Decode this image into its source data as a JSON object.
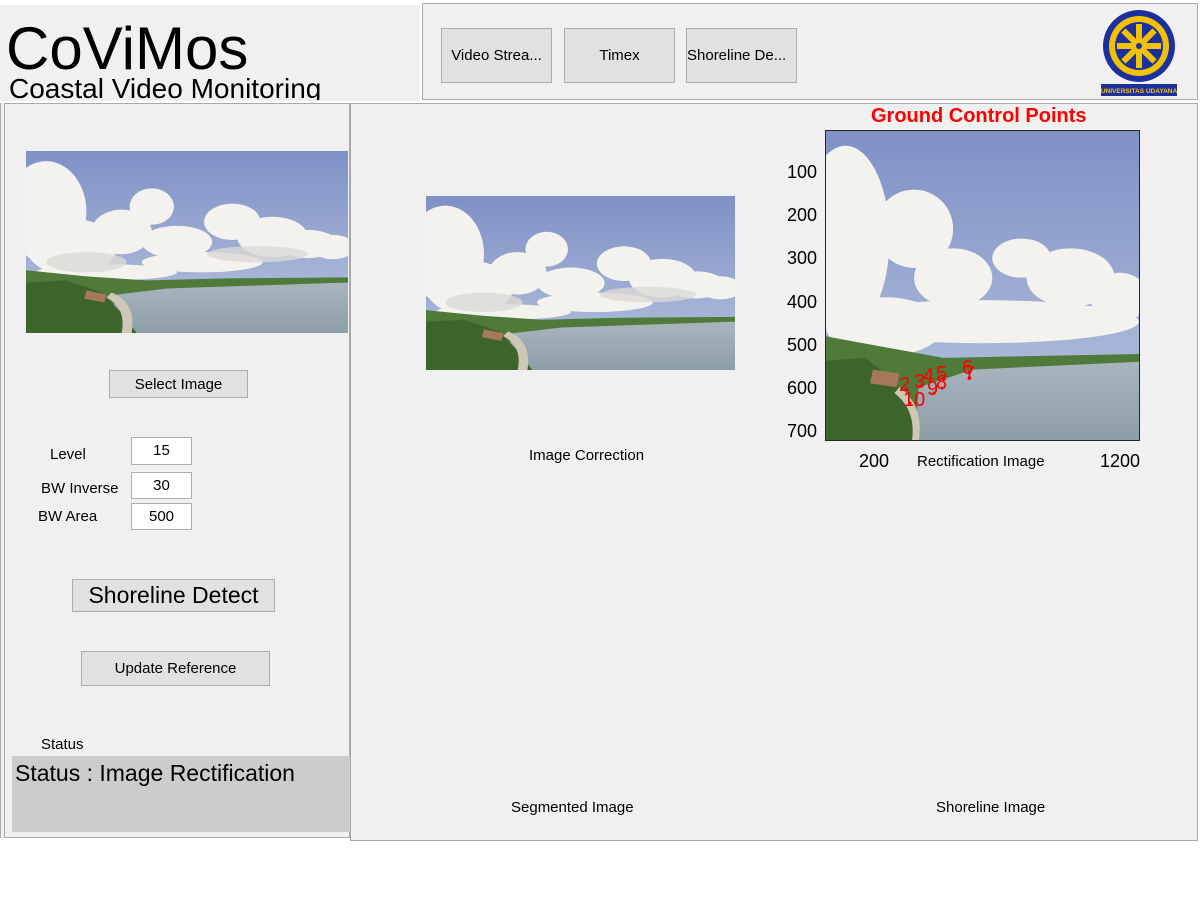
{
  "header": {
    "app_title": "CoViMos",
    "app_subtitle": "Coastal Video Monitoring",
    "nav_buttons": [
      "Video Strea...",
      "Timex",
      "Shoreline De..."
    ],
    "logo_text": "UNIVERSITAS UDAYANA"
  },
  "controls": {
    "select_image_label": "Select Image",
    "level_label": "Level",
    "level_value": "15",
    "bw_inverse_label": "BW Inverse",
    "bw_inverse_value": "30",
    "bw_area_label": "BW Area",
    "bw_area_value": "500",
    "shoreline_detect_label": "Shoreline Detect",
    "update_reference_label": "Update Reference",
    "status_label": "Status",
    "status_text": "Status : Image Rectification"
  },
  "axes": {
    "image_correction_caption": "Image Correction",
    "rectification_title": "Ground Control Points",
    "rectification_caption": "Rectification Image",
    "rectification_y_ticks": [
      "100",
      "200",
      "300",
      "400",
      "500",
      "600",
      "700"
    ],
    "rectification_x_ticks": [
      "200",
      "1200"
    ],
    "gcp_labels": [
      "2",
      "3",
      "4",
      "5",
      "6",
      "7",
      "8",
      "9",
      "10"
    ],
    "segmented_caption": "Segmented Image",
    "shoreline_caption": "Shoreline Image"
  },
  "colors": {
    "panel_bg": "#f0f0f0",
    "title_red": "#ff0000",
    "status_bg": "#cccccc",
    "logo_blue": "#1b2f9e",
    "logo_gold": "#f2c200"
  }
}
